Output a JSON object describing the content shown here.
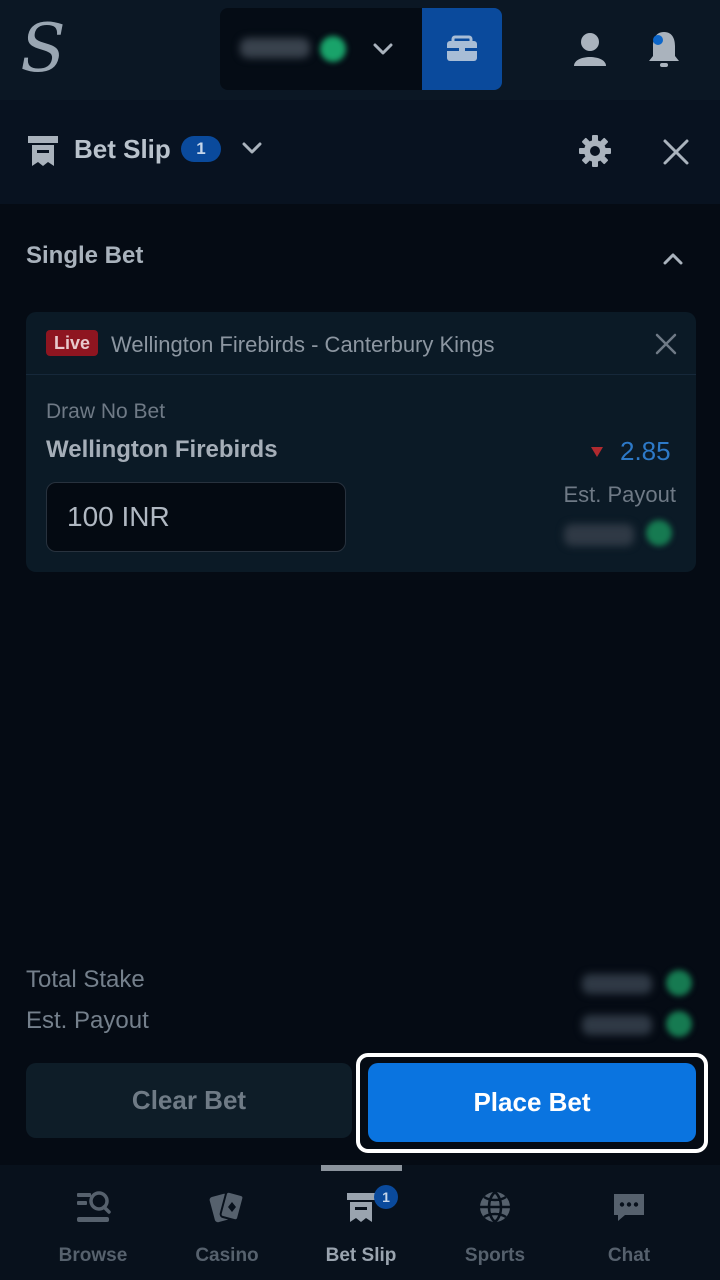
{
  "header": {
    "logo_text": "S"
  },
  "bet_slip": {
    "title": "Bet Slip",
    "count": "1"
  },
  "single_bet": {
    "section_title": "Single Bet",
    "live_label": "Live",
    "match": "Wellington Firebirds - Canterbury Kings",
    "market": "Draw No Bet",
    "selection": "Wellington Firebirds",
    "odds": "2.85",
    "stake_value": "100 INR",
    "est_payout_label": "Est. Payout"
  },
  "totals": {
    "total_stake_label": "Total Stake",
    "est_payout_label": "Est. Payout"
  },
  "actions": {
    "clear_label": "Clear Bet",
    "place_label": "Place Bet"
  },
  "bottom_nav": {
    "items": [
      {
        "label": "Browse",
        "icon": "browse-icon"
      },
      {
        "label": "Casino",
        "icon": "casino-icon"
      },
      {
        "label": "Bet Slip",
        "icon": "bet-slip-icon",
        "badge": "1",
        "active": true
      },
      {
        "label": "Sports",
        "icon": "sports-icon"
      },
      {
        "label": "Chat",
        "icon": "chat-icon"
      }
    ]
  },
  "colors": {
    "accent_blue": "#0a74e0",
    "live_red": "#8e1520",
    "odds_blue": "#2d79c7"
  }
}
